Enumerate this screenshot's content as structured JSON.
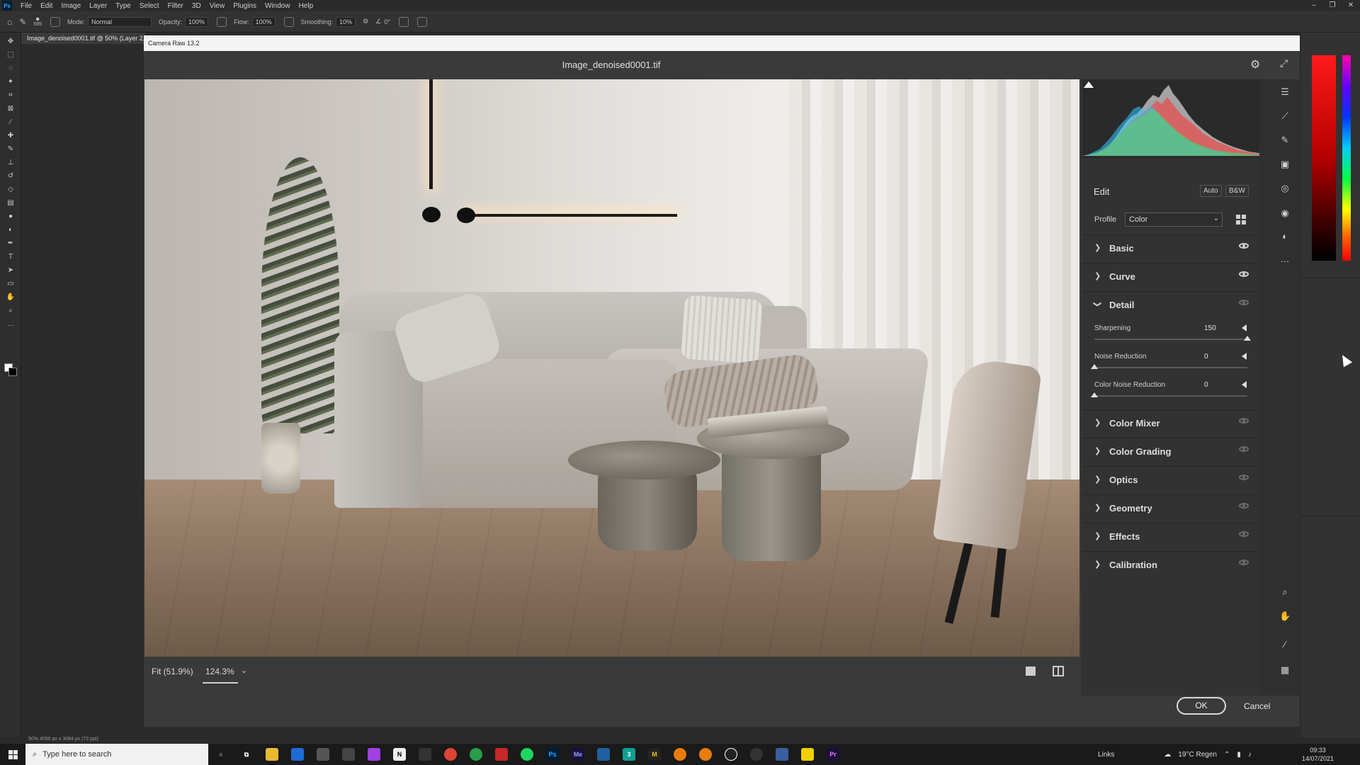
{
  "photoshop": {
    "menu": [
      "File",
      "Edit",
      "Image",
      "Layer",
      "Type",
      "Select",
      "Filter",
      "3D",
      "View",
      "Plugins",
      "Window",
      "Help"
    ],
    "options": {
      "mode_label": "Mode:",
      "mode_value": "Normal",
      "opacity_label": "Opacity:",
      "opacity_value": "100%",
      "flow_label": "Flow:",
      "flow_value": "100%",
      "smoothing_label": "Smoothing:",
      "smoothing_value": "10%",
      "angle_value": "0°",
      "brush_size": "595"
    },
    "doc_tab": "Image_denoised0001.tif @ 50% (Layer 2, R",
    "status": "50%      4096 px x 3084 px (72 ppi)"
  },
  "camera_raw": {
    "title": "Camera Raw 13.2",
    "filename": "Image_denoised0001.tif",
    "zoom_fit": "Fit (51.9%)",
    "zoom_value": "124.3%",
    "edit": {
      "label": "Edit",
      "auto": "Auto",
      "bw": "B&W",
      "profile_label": "Profile",
      "profile_value": "Color"
    },
    "sections": {
      "basic": "Basic",
      "curve": "Curve",
      "detail": "Detail",
      "color_mixer": "Color Mixer",
      "color_grading": "Color Grading",
      "optics": "Optics",
      "geometry": "Geometry",
      "effects": "Effects",
      "calibration": "Calibration"
    },
    "detail": {
      "sharpening": {
        "label": "Sharpening",
        "value": "150",
        "fraction": 1.0
      },
      "noise_reduction": {
        "label": "Noise Reduction",
        "value": "0",
        "fraction": 0.0
      },
      "color_noise_reduction": {
        "label": "Color Noise Reduction",
        "value": "0",
        "fraction": 0.0
      }
    },
    "ok": "OK",
    "cancel": "Cancel"
  },
  "taskbar": {
    "search_placeholder": "Type here to search",
    "links": "Links",
    "weather": "19°C  Regen",
    "time": "09:33",
    "date": "14/07/2021"
  }
}
